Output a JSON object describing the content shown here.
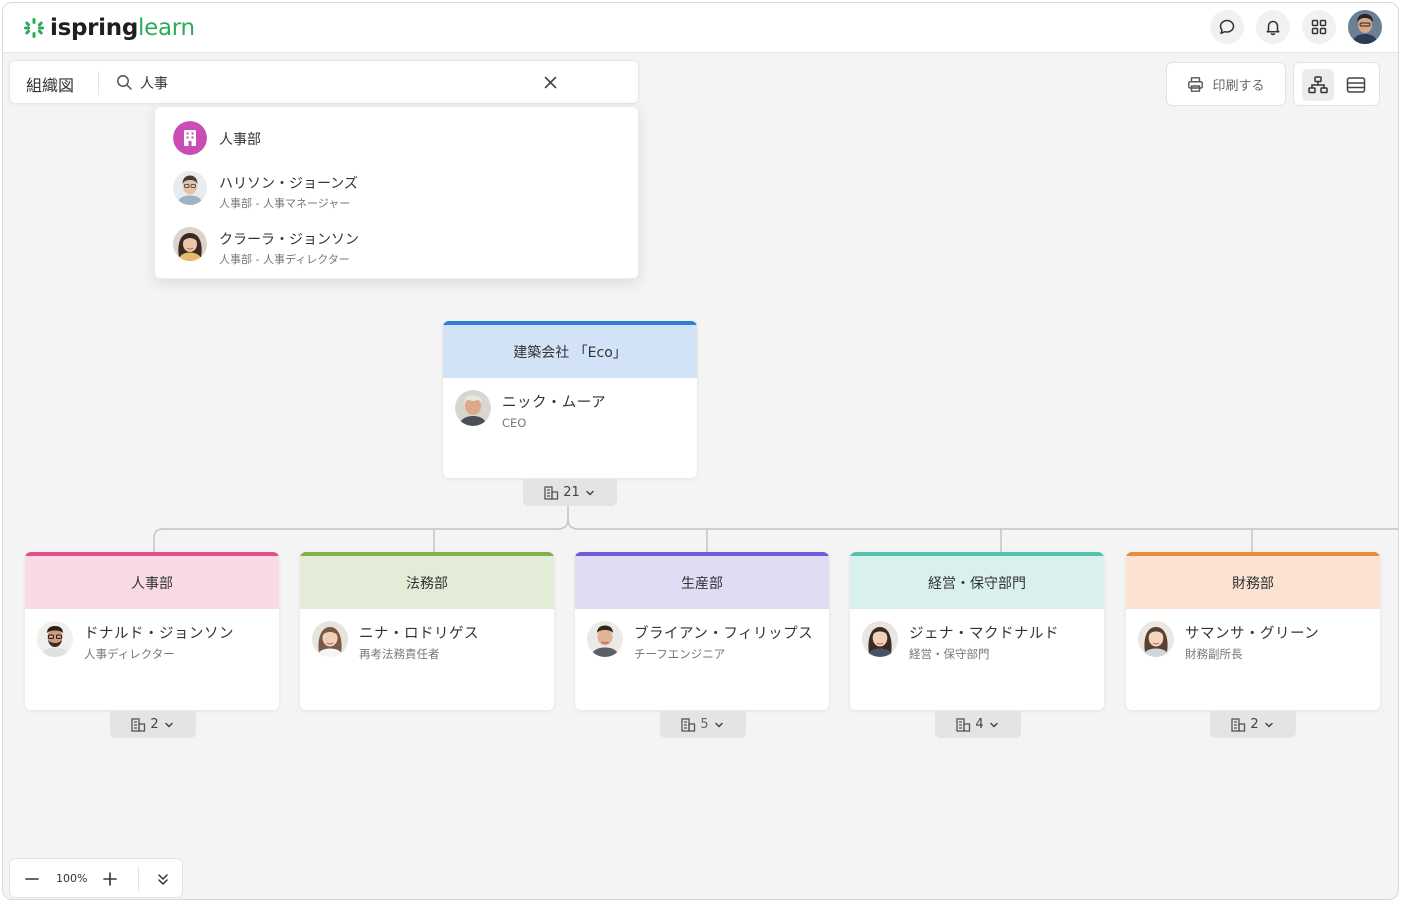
{
  "app": {
    "logo_part1": "ispring",
    "logo_part2": "learn",
    "brand_color": "#2eaa5b"
  },
  "topbar": {
    "icons": [
      "chat-icon",
      "bell-icon",
      "apps-grid-icon",
      "user-avatar"
    ]
  },
  "search": {
    "page_title": "組織図",
    "query": "人事",
    "results": [
      {
        "name": "人事部",
        "subtitle": "",
        "type": "department",
        "color": "#c94db5"
      },
      {
        "name": "ハリソン・ジョーンズ",
        "subtitle": "人事部 - 人事マネージャー",
        "type": "person"
      },
      {
        "name": "クラーラ・ジョンソン",
        "subtitle": "人事部 - 人事ディレクター",
        "type": "person"
      }
    ]
  },
  "toolbar": {
    "print_label": "印刷する",
    "views": [
      "org-chart-view",
      "list-view"
    ],
    "active_view": "org-chart-view"
  },
  "root": {
    "title": "建築会社 「Eco」",
    "name": "ニック・ムーア",
    "role": "CEO",
    "count": "21",
    "color": "#2f7fd8",
    "head_bg": "#d3e3f7"
  },
  "departments": [
    {
      "title": "人事部",
      "name": "ドナルド・ジョンソン",
      "role": "人事ディレクター",
      "count": "2",
      "color": "#e2508c",
      "head_bg": "#f9d9e5"
    },
    {
      "title": "法務部",
      "name": "ニナ・ロドリゲス",
      "role": "再考法務責任者",
      "count": "",
      "color": "#7fb24a",
      "head_bg": "#e2ecd7"
    },
    {
      "title": "生産部",
      "name": "ブライアン・フィリップス",
      "role": "チーフエンジニア",
      "count": "5",
      "color": "#7359d8",
      "head_bg": "#e0dcf4"
    },
    {
      "title": "経営・保守部門",
      "name": "ジェナ・マクドナルド",
      "role": "経営・保守部門",
      "count": "4",
      "color": "#55c2b0",
      "head_bg": "#d9f0ec"
    },
    {
      "title": "財務部",
      "name": "サマンサ・グリーン",
      "role": "財務副所長",
      "count": "2",
      "color": "#f08a38",
      "head_bg": "#fbe2d2"
    }
  ],
  "zoom": {
    "level": "100%"
  }
}
